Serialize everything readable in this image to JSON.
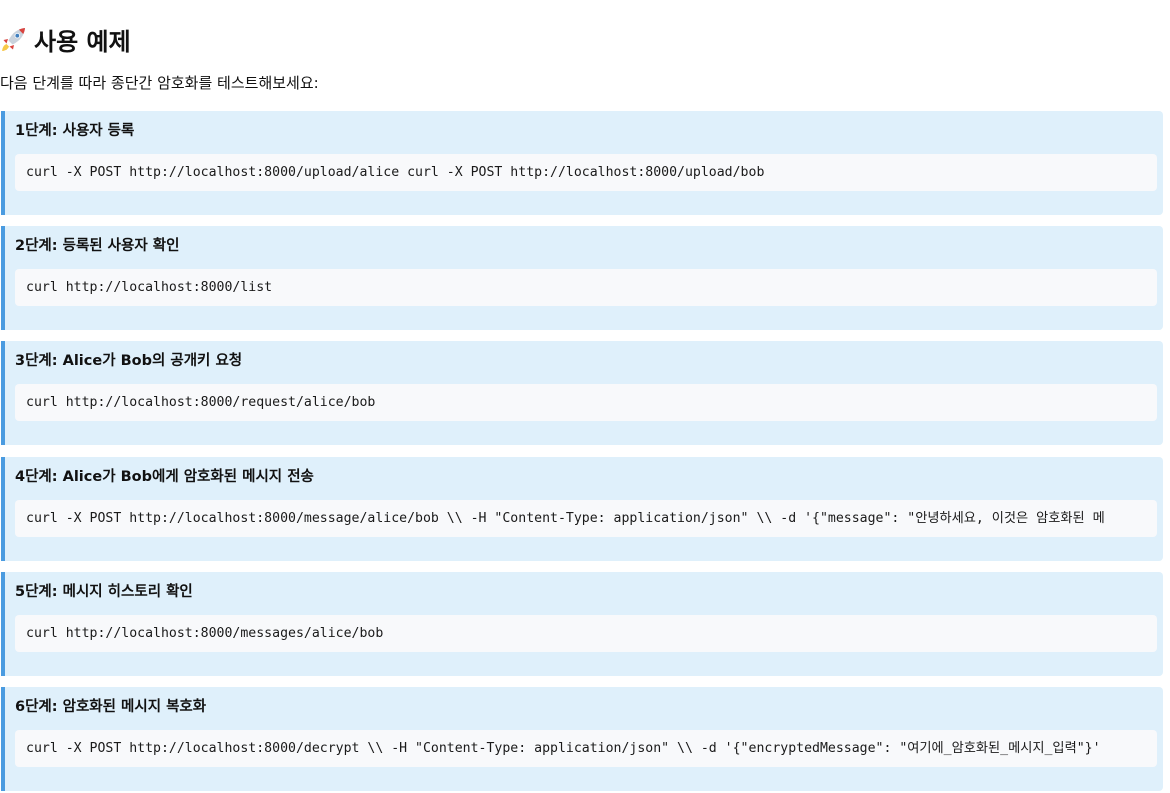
{
  "header": {
    "icon": "rocket-icon",
    "title": "사용 예제",
    "intro": "다음 단계를 따라 종단간 암호화를 테스트해보세요:"
  },
  "colors": {
    "step_background": "#dff0fb",
    "step_accent": "#4a9be0",
    "code_background": "#f8f9fb"
  },
  "steps": [
    {
      "title": "1단계: 사용자 등록",
      "code": "curl -X POST http://localhost:8000/upload/alice curl -X POST http://localhost:8000/upload/bob"
    },
    {
      "title": "2단계: 등록된 사용자 확인",
      "code": "curl http://localhost:8000/list"
    },
    {
      "title": "3단계: Alice가 Bob의 공개키 요청",
      "code": "curl http://localhost:8000/request/alice/bob"
    },
    {
      "title": "4단계: Alice가 Bob에게 암호화된 메시지 전송",
      "code": "curl -X POST http://localhost:8000/message/alice/bob \\\\ -H \"Content-Type: application/json\" \\\\ -d '{\"message\": \"안녕하세요, 이것은 암호화된 메"
    },
    {
      "title": "5단계: 메시지 히스토리 확인",
      "code": "curl http://localhost:8000/messages/alice/bob"
    },
    {
      "title": "6단계: 암호화된 메시지 복호화",
      "code": "curl -X POST http://localhost:8000/decrypt \\\\ -H \"Content-Type: application/json\" \\\\ -d '{\"encryptedMessage\": \"여기에_암호화된_메시지_입력\"}'"
    }
  ]
}
